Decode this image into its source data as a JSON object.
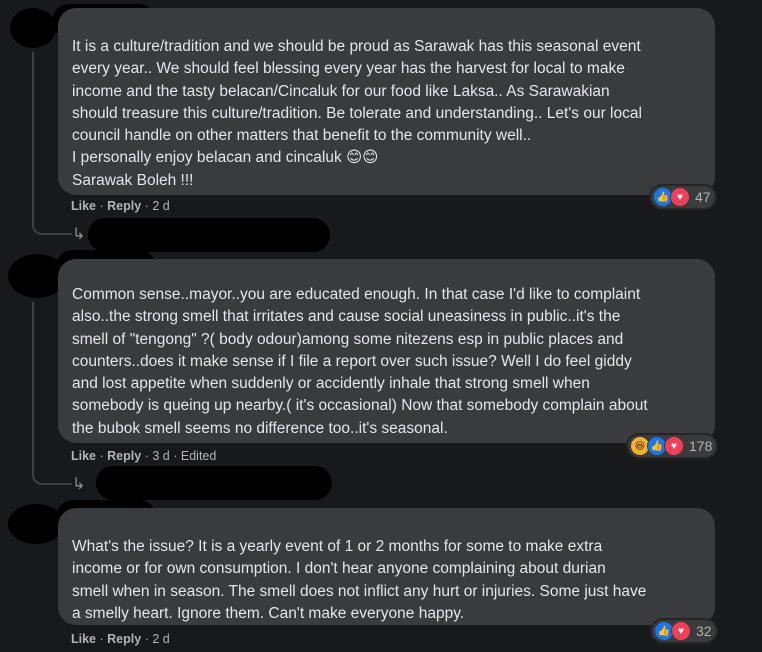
{
  "comments": [
    {
      "text": "It is a culture/tradition and we should be proud as Sarawak has this seasonal event\nevery year.. We should feel blessing every year has the harvest for local to make\nincome and the tasty belacan/Cincaluk for our food like Laksa.. As Sarawakian\nshould treasure this culture/tradition. Be tolerate and understanding.. Let's our local\ncouncil handle on other matters that benefit to the community well..\nI personally enjoy belacan and cincaluk 😊😊\nSarawak Boleh !!!",
      "like_label": "Like",
      "reply_label": "Reply",
      "time": "2 d",
      "edited": "",
      "reaction_count": "47",
      "reactions": [
        "like-icon",
        "love-icon"
      ]
    },
    {
      "text": "Common sense..mayor..you are educated enough. In that case I'd like to complaint\nalso..the strong smell that irritates and cause social uneasiness in public..it's the\nsmell of \"tengong\" ?( body odour)among some nitezens esp in public places and\ncounters..does it make sense if I file a report over such issue? Well I do feel giddy\nand lost appetite when suddenly or accidently inhale that strong smell when\nsomebody is queing up nearby.( it's occasional) Now that somebody complain about\nthe bubok smell seems no difference too..it's seasonal.",
      "like_label": "Like",
      "reply_label": "Reply",
      "time": "3 d",
      "edited": "Edited",
      "reaction_count": "178",
      "reactions": [
        "haha-icon",
        "like-icon",
        "love-icon"
      ]
    },
    {
      "text": "What's the issue? It is a yearly event of 1 or 2 months for some to make extra\nincome or for own consumption. I don't hear anyone complaining about durian\nsmell when in season. The smell does not inflict any hurt or injuries. Some just have\na smelly heart. Ignore them. Can't make everyone happy.",
      "like_label": "Like",
      "reply_label": "Reply",
      "time": "2 d",
      "edited": "",
      "reaction_count": "32",
      "reactions": [
        "like-icon",
        "love-icon"
      ]
    }
  ],
  "separator": "·",
  "colors": {
    "background": "#18191a",
    "bubble": "#3a3b3c",
    "like": "#1877f2",
    "love": "#f33e58",
    "haha": "#f7b125"
  }
}
